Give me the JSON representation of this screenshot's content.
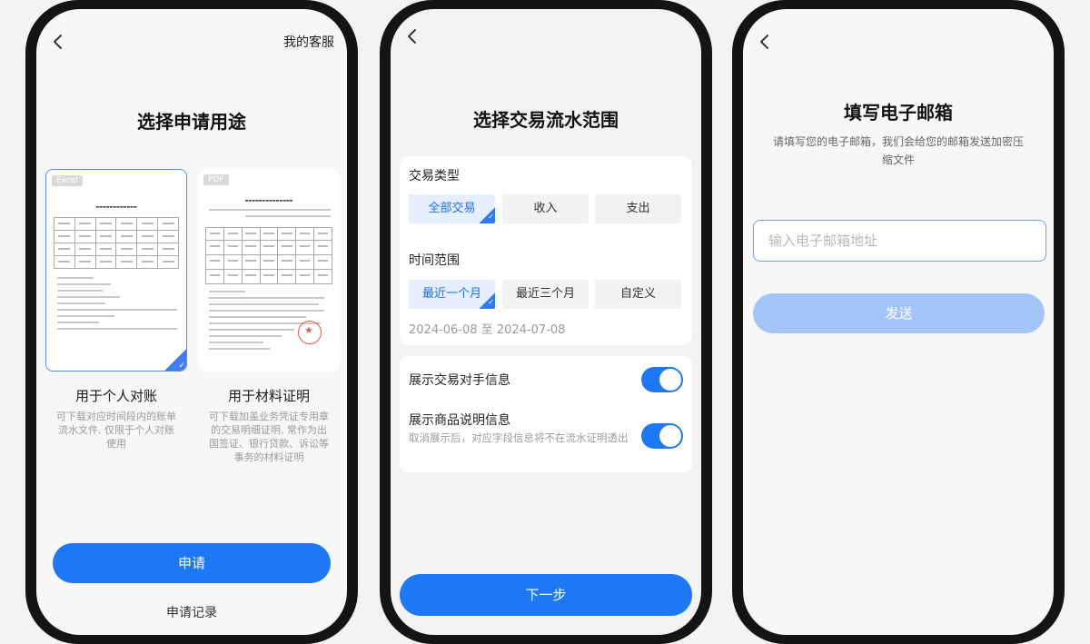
{
  "colors": {
    "primary": "#1e78f5",
    "disabled_button": "#a3c4f6",
    "selected_chip_bg": "#e5efff",
    "stamp_red": "#e35a4a"
  },
  "screen1": {
    "back_icon": "back-arrow-icon",
    "customer_service": "我的客服",
    "title": "选择申请用途",
    "options": [
      {
        "tag": "Excel",
        "title": "用于个人对账",
        "description": "可下载对应时间段内的账单流水文件, 仅限于个人对账使用",
        "selected": true
      },
      {
        "tag": "PDF",
        "title": "用于材料证明",
        "description": "可下载加盖业务凭证专用章的交易明细证明, 常作为出国签证、银行贷款、诉讼等事务的材料证明",
        "selected": false
      }
    ],
    "apply_button": "申请",
    "records_link": "申请记录"
  },
  "screen2": {
    "back_icon": "back-arrow-icon",
    "title": "选择交易流水范围",
    "transaction_type": {
      "label": "交易类型",
      "options": [
        "全部交易",
        "收入",
        "支出"
      ],
      "selected": "全部交易"
    },
    "time_range": {
      "label": "时间范围",
      "options": [
        "最近一个月",
        "最近三个月",
        "自定义"
      ],
      "selected": "最近一个月",
      "date_range": "2024-06-08 至 2024-07-08"
    },
    "toggles": [
      {
        "label": "展示交易对手信息",
        "note": "",
        "on": true
      },
      {
        "label": "展示商品说明信息",
        "note": "取消展示后，对应字段信息将不在流水证明透出",
        "on": true
      }
    ],
    "next_button": "下一步"
  },
  "screen3": {
    "back_icon": "back-arrow-icon",
    "title": "填写电子邮箱",
    "subtitle": "请填写您的电子邮箱，我们会给您的邮箱发送加密压缩文件",
    "email_placeholder": "输入电子邮箱地址",
    "email_value": "",
    "send_button": "发送"
  }
}
